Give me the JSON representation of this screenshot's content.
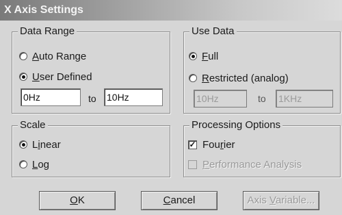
{
  "window": {
    "title": "X Axis Settings"
  },
  "data_range": {
    "title": "Data Range",
    "auto_range": {
      "prefix": "",
      "mnemonic": "A",
      "rest": "uto Range",
      "selected": false
    },
    "user_defined": {
      "prefix": "",
      "mnemonic": "U",
      "rest": "ser Defined",
      "selected": true
    },
    "from_value": "0Hz",
    "to_label": "to",
    "to_value": "10Hz"
  },
  "use_data": {
    "title": "Use Data",
    "full": {
      "prefix": "",
      "mnemonic": "F",
      "rest": "ull",
      "selected": true
    },
    "restricted": {
      "prefix": "",
      "mnemonic": "R",
      "rest": "estricted (analog)",
      "selected": false
    },
    "from_value": "10Hz",
    "to_label": "to",
    "to_value": "1KHz"
  },
  "scale": {
    "title": "Scale",
    "linear": {
      "prefix": "L",
      "mnemonic": "i",
      "rest": "near",
      "selected": true
    },
    "log": {
      "prefix": "",
      "mnemonic": "L",
      "rest": "og",
      "selected": false
    }
  },
  "processing": {
    "title": "Processing Options",
    "fourier": {
      "prefix": "Fou",
      "mnemonic": "r",
      "rest": "ier",
      "checked": true
    },
    "performance": {
      "prefix": "",
      "mnemonic": "P",
      "rest": "erformance Analysis",
      "checked": false,
      "disabled": true
    }
  },
  "buttons": {
    "ok": {
      "prefix": "",
      "mnemonic": "O",
      "rest": "K"
    },
    "cancel": {
      "prefix": "",
      "mnemonic": "C",
      "rest": "ancel"
    },
    "axis_variable": {
      "prefix": "Axis ",
      "mnemonic": "V",
      "rest": "ariable...",
      "disabled": true
    }
  },
  "icons": {
    "check_mark": "check-icon",
    "radio_dot": "radio-dot-icon"
  }
}
